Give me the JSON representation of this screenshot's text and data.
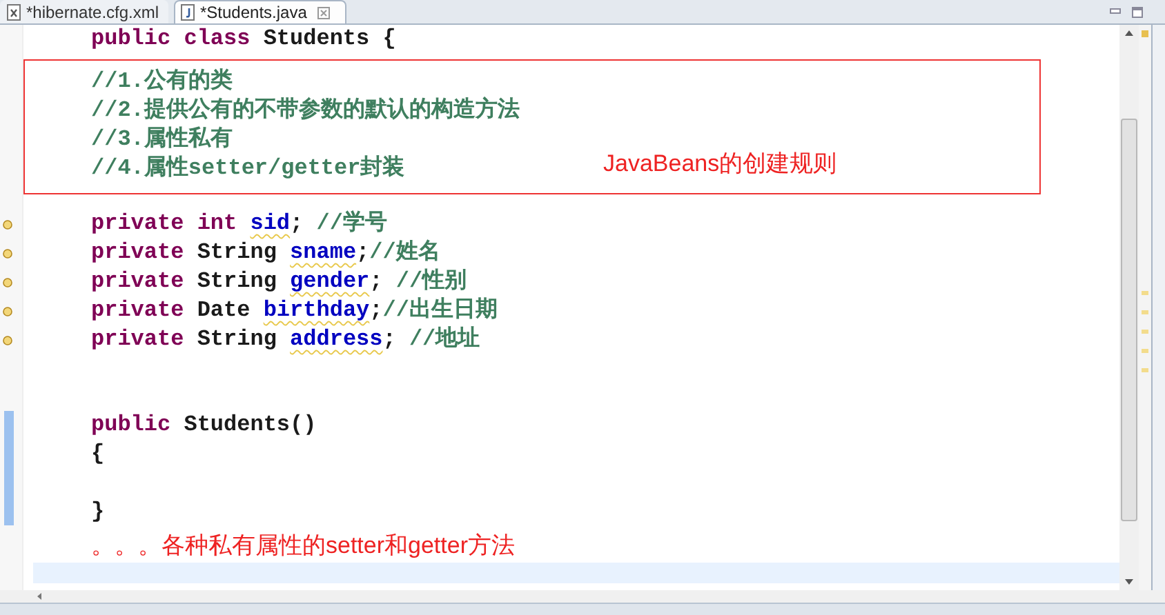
{
  "tabs": [
    {
      "label": "*hibernate.cfg.xml",
      "kind": "xml",
      "selected": false
    },
    {
      "label": "*Students.java",
      "kind": "java",
      "selected": true
    }
  ],
  "header_line": [
    {
      "kind": "keyword",
      "text": "public class"
    },
    {
      "kind": "plain",
      "text": " Students {"
    }
  ],
  "annotation": {
    "lines": [
      "//1.公有的类",
      "//2.提供公有的不带参数的默认的构造方法",
      "//3.属性私有",
      "//4.属性setter/getter封装"
    ],
    "label": "JavaBeans的创建规则"
  },
  "fields": [
    {
      "marker": true,
      "tokens": [
        {
          "kind": "keyword",
          "text": "private int "
        },
        {
          "kind": "field",
          "text": "sid",
          "warning": true
        },
        {
          "kind": "plain",
          "text": "; "
        },
        {
          "kind": "comment",
          "text": "//学号"
        }
      ]
    },
    {
      "marker": true,
      "tokens": [
        {
          "kind": "keyword",
          "text": "private "
        },
        {
          "kind": "plain",
          "text": "String "
        },
        {
          "kind": "field",
          "text": "sname",
          "warning": true
        },
        {
          "kind": "plain",
          "text": ";"
        },
        {
          "kind": "comment",
          "text": "//姓名"
        }
      ]
    },
    {
      "marker": true,
      "tokens": [
        {
          "kind": "keyword",
          "text": "private "
        },
        {
          "kind": "plain",
          "text": "String "
        },
        {
          "kind": "field",
          "text": "gender",
          "warning": true
        },
        {
          "kind": "plain",
          "text": "; "
        },
        {
          "kind": "comment",
          "text": "//性别"
        }
      ]
    },
    {
      "marker": true,
      "tokens": [
        {
          "kind": "keyword",
          "text": "private "
        },
        {
          "kind": "plain",
          "text": "Date "
        },
        {
          "kind": "field",
          "text": "birthday",
          "warning": true
        },
        {
          "kind": "plain",
          "text": ";"
        },
        {
          "kind": "comment",
          "text": "//出生日期"
        }
      ]
    },
    {
      "marker": true,
      "tokens": [
        {
          "kind": "keyword",
          "text": "private "
        },
        {
          "kind": "plain",
          "text": "String "
        },
        {
          "kind": "field",
          "text": "address",
          "warning": true
        },
        {
          "kind": "plain",
          "text": "; "
        },
        {
          "kind": "comment",
          "text": "//地址"
        }
      ]
    }
  ],
  "constructor": [
    [
      {
        "kind": "keyword",
        "text": "public "
      },
      {
        "kind": "plain",
        "text": "Students()"
      }
    ],
    [
      {
        "kind": "plain",
        "text": "{"
      }
    ],
    [
      {
        "kind": "plain",
        "text": "}"
      }
    ]
  ],
  "note": "。。。各种私有属性的setter和getter方法"
}
